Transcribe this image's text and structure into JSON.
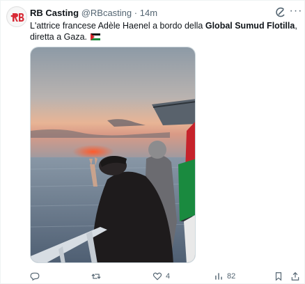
{
  "tweet": {
    "author_name": "RB Casting",
    "author_handle": "@RBcasting",
    "separator": "·",
    "time": "14m",
    "text_before": "L'attrice francese Adèle Haenel a bordo della ",
    "text_bold": "Global Sumud Flotilla",
    "text_after": ", diretta a Gaza.",
    "flag_icon": "palestine-flag-icon",
    "colors": {
      "text": "#0f1419",
      "muted": "#536471",
      "border": "#cfd9de"
    }
  },
  "actions": {
    "reply": {
      "icon": "reply-icon",
      "count": ""
    },
    "retweet": {
      "icon": "retweet-icon",
      "count": ""
    },
    "like": {
      "icon": "heart-icon",
      "count": "4"
    },
    "views": {
      "icon": "views-icon",
      "count": "82"
    },
    "bookmark": {
      "icon": "bookmark-icon"
    },
    "share": {
      "icon": "share-icon"
    }
  }
}
